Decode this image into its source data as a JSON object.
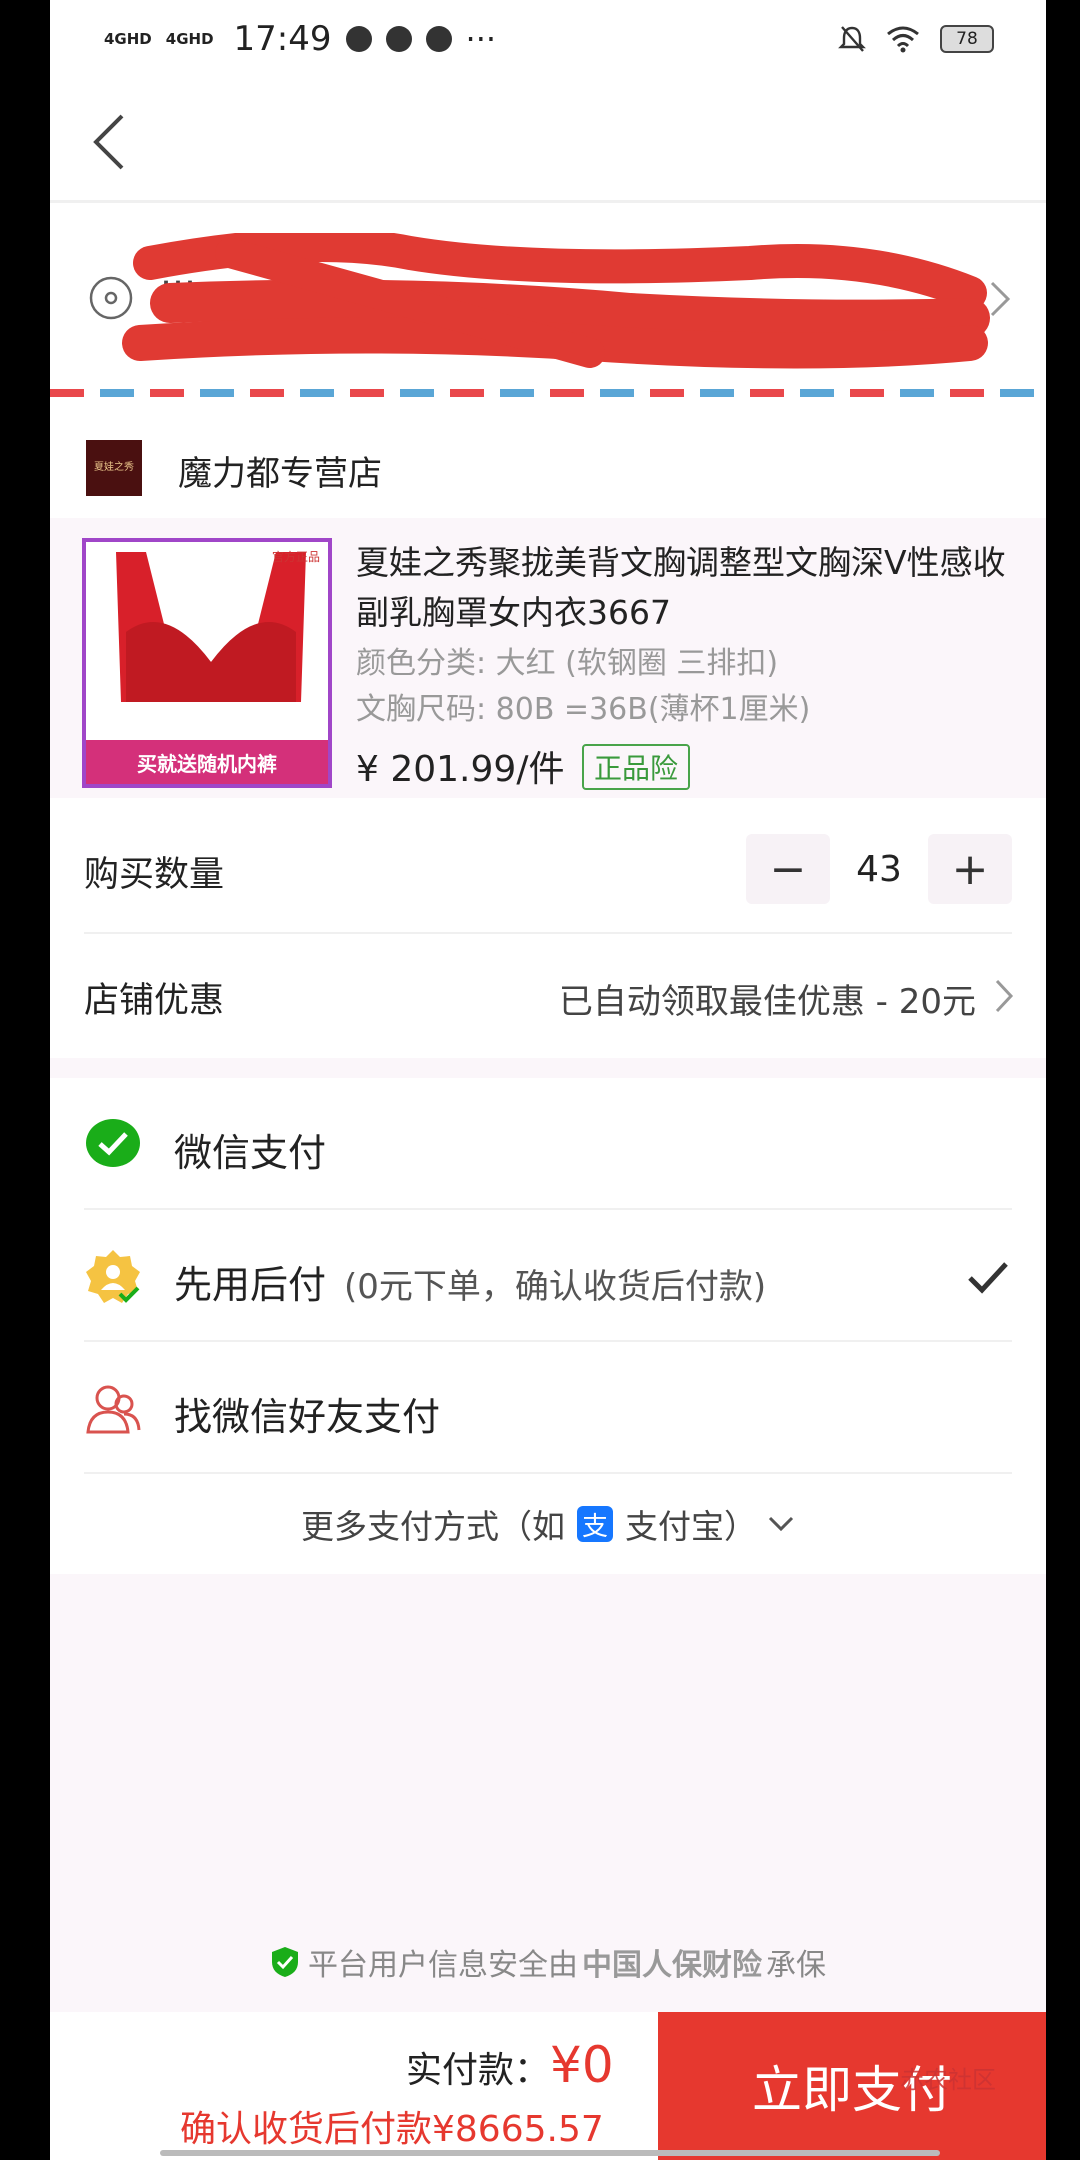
{
  "status_bar": {
    "net1": "4GHD",
    "net2": "4GHD",
    "time": "17:49",
    "more": "···",
    "battery": "78"
  },
  "address": {
    "line1": "…",
    "line2": "…"
  },
  "shop": {
    "logo_text": "夏娃之秀",
    "name": "魔力都专营店"
  },
  "product": {
    "title": "夏娃之秀聚拢美背文胸调整型文胸深V性感收副乳胸罩女内衣3667",
    "spec_color": "颜色分类: 大红 (软钢圈 三排扣)",
    "spec_size": "文胸尺码: 80B =36B(薄杯1厘米)",
    "price": "¥ 201.99/件",
    "badge": "正品险",
    "thumb_banner": "买就送随机内裤",
    "thumb_tag": "官方正品"
  },
  "quantity": {
    "label": "购买数量",
    "minus": "−",
    "value": "43",
    "plus": "+"
  },
  "coupon": {
    "label": "店铺优惠",
    "value": "已自动领取最佳优惠 - 20元"
  },
  "payment": {
    "wechat": "微信支付",
    "later": "先用后付",
    "later_sub": "(0元下单，确认收货后付款)",
    "friend": "找微信好友支付",
    "more_prefix": "更多支付方式（如",
    "alipay_icon": "支",
    "more_suffix": "支付宝）"
  },
  "security": {
    "prefix": "平台用户信息安全由",
    "insurer": "中国人保财险",
    "suffix": "承保"
  },
  "bottom": {
    "paid_label": "实付款：",
    "paid_amount": "¥0",
    "after_text": "确认收货后付款¥8665.57",
    "pay_button": "立即支付",
    "watermark": "赤农社区"
  },
  "colors": {
    "accent": "#e6382f",
    "wechat_green": "#1aad19",
    "badge_green": "#3a9a3c",
    "alipay_blue": "#1677ff"
  }
}
